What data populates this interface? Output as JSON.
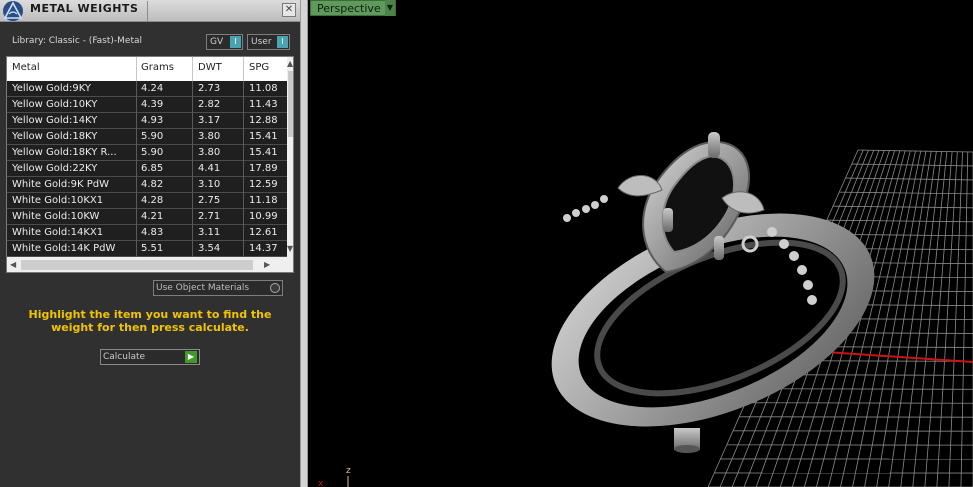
{
  "panel": {
    "title": "METAL WEIGHTS",
    "close_glyph": "✕",
    "logo_icon": "triangle-logo-icon",
    "library_label": "Library: Classic - (Fast)-Metal",
    "gv_label": "GV",
    "user_label": "User",
    "table": {
      "columns": [
        "Metal",
        "Grams",
        "DWT",
        "SPG"
      ],
      "rows": [
        [
          "Yellow Gold:9KY",
          "4.24",
          "2.73",
          "11.08"
        ],
        [
          "Yellow Gold:10KY",
          "4.39",
          "2.82",
          "11.43"
        ],
        [
          "Yellow Gold:14KY",
          "4.93",
          "3.17",
          "12.88"
        ],
        [
          "Yellow Gold:18KY",
          "5.90",
          "3.80",
          "15.41"
        ],
        [
          "Yellow Gold:18KY R...",
          "5.90",
          "3.80",
          "15.41"
        ],
        [
          "Yellow Gold:22KY",
          "6.85",
          "4.41",
          "17.89"
        ],
        [
          "White Gold:9K PdW",
          "4.82",
          "3.10",
          "12.59"
        ],
        [
          "White Gold:10KX1",
          "4.28",
          "2.75",
          "11.18"
        ],
        [
          "White Gold:10KW",
          "4.21",
          "2.71",
          "10.99"
        ],
        [
          "White Gold:14KX1",
          "4.83",
          "3.11",
          "12.61"
        ],
        [
          "White Gold:14K PdW",
          "5.51",
          "3.54",
          "14.37"
        ]
      ]
    },
    "use_object_materials": "Use Object Materials",
    "hint": "Highlight the item you want to find the weight for then press calculate.",
    "calculate_label": "Calculate"
  },
  "viewport": {
    "view_label": "Perspective",
    "axis_labels": {
      "x": "x",
      "z": "z"
    },
    "grid_axis_color": "#c81414",
    "ring_color": "#9a9a9a"
  }
}
